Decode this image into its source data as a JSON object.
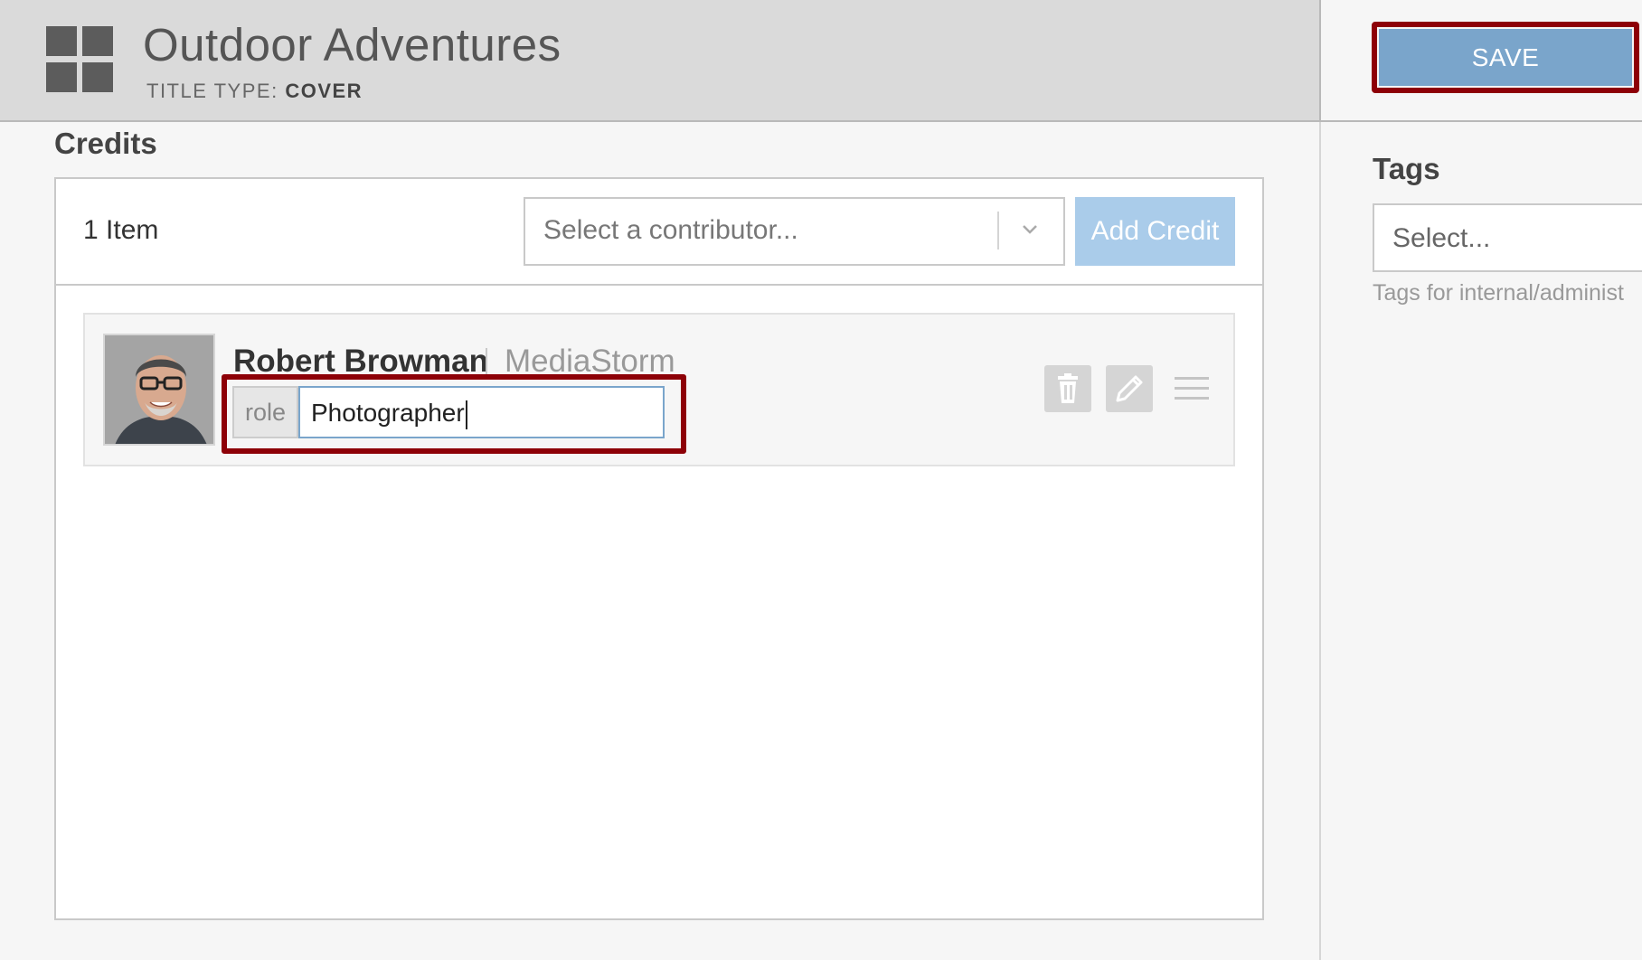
{
  "header": {
    "title": "Outdoor Adventures",
    "title_type_label": "TITLE TYPE:",
    "title_type_value": "COVER"
  },
  "toolbar": {
    "save_label": "SAVE"
  },
  "tags": {
    "heading": "Tags",
    "placeholder": "Select...",
    "help_text": "Tags for internal/administ"
  },
  "credits": {
    "heading": "Credits",
    "item_count": "1 Item",
    "contributor_placeholder": "Select a contributor...",
    "add_credit_label": "Add Credit",
    "items": [
      {
        "name": "Robert Browman",
        "organization": "MediaStorm",
        "role_label": "role",
        "role_value": "Photographer"
      }
    ]
  },
  "colors": {
    "accent_blue": "#7aa5cb",
    "highlight_red": "#8d0007",
    "header_gray": "#dadada"
  },
  "icons": [
    "grid-logo-icon",
    "chevron-down-icon",
    "trash-icon",
    "pencil-icon",
    "drag-handle-icon"
  ]
}
